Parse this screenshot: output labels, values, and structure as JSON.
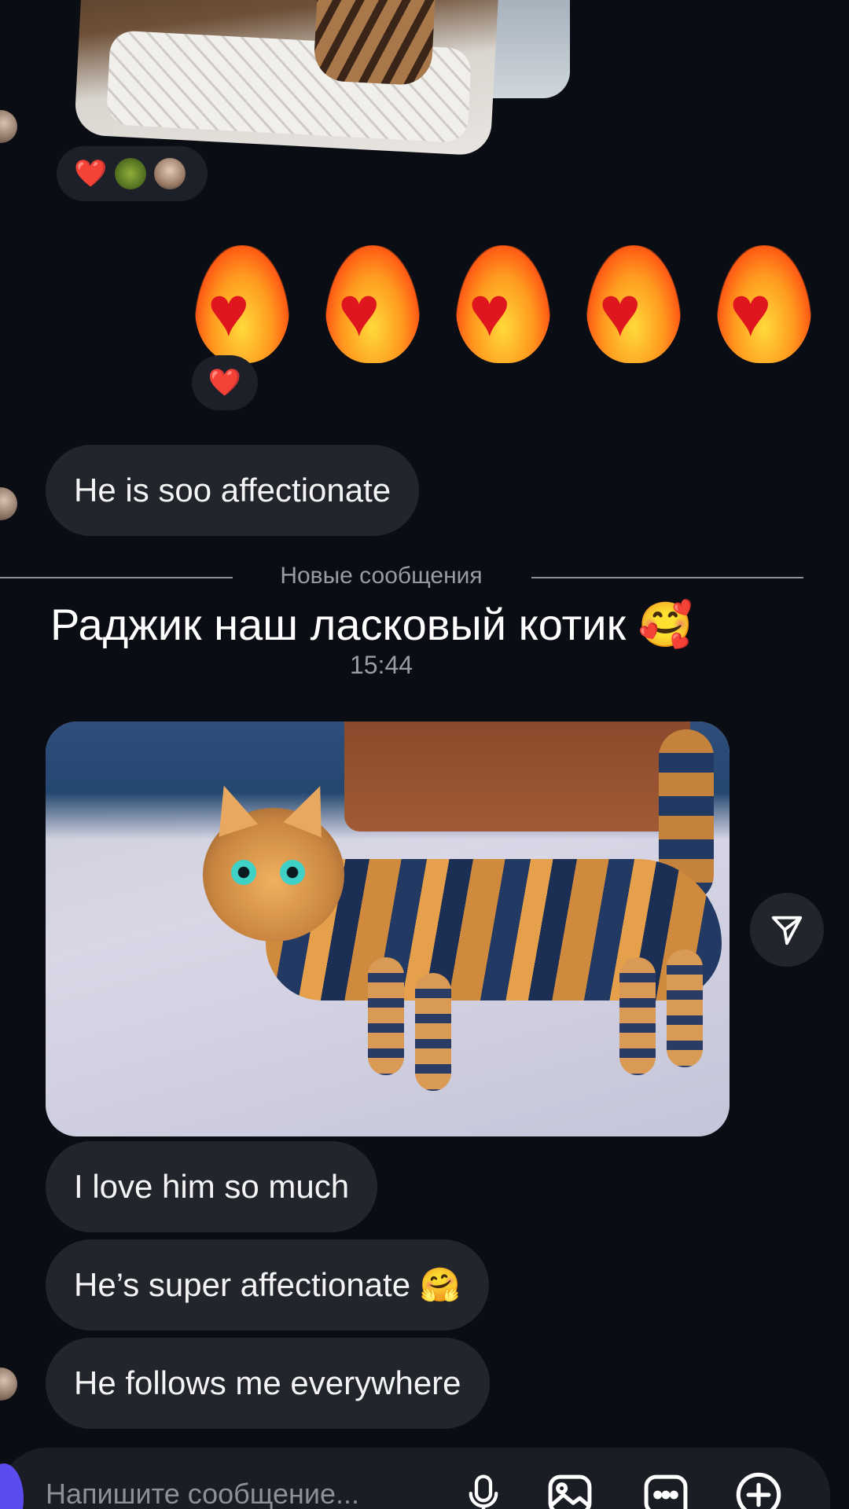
{
  "messages": {
    "reaction_1": "❤️",
    "fire_hearts": [
      "❤️‍🔥",
      "❤️‍🔥",
      "❤️‍🔥",
      "❤️‍🔥",
      "❤️‍🔥"
    ],
    "reaction_2": "❤️",
    "msg_affectionate": "He is soo affectionate",
    "new_messages_divider": "Новые сообщения",
    "headline": "Раджик наш ласковый котик 🥰",
    "time": "15:44",
    "msg_love": "I love him so much",
    "msg_super": "He’s super affectionate 🤗",
    "msg_follows": "He follows me everywhere"
  },
  "composer": {
    "placeholder": "Напишите сообщение..."
  },
  "icons": {
    "mic": "mic-icon",
    "gallery": "image-icon",
    "more": "more-icon",
    "add": "plus-icon",
    "share": "send-icon"
  },
  "colors": {
    "background": "#0b0d14",
    "bubble": "#23252d",
    "accent": "#5b4cf0"
  }
}
